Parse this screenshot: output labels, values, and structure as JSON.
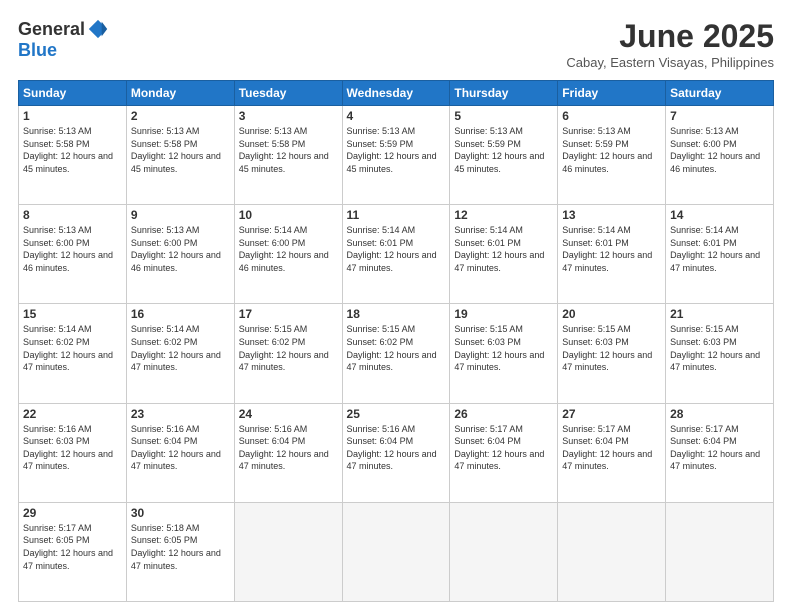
{
  "header": {
    "logo_general": "General",
    "logo_blue": "Blue",
    "month_title": "June 2025",
    "location": "Cabay, Eastern Visayas, Philippines"
  },
  "calendar": {
    "days_of_week": [
      "Sunday",
      "Monday",
      "Tuesday",
      "Wednesday",
      "Thursday",
      "Friday",
      "Saturday"
    ],
    "weeks": [
      [
        {
          "day": null,
          "empty": true
        },
        {
          "day": null,
          "empty": true
        },
        {
          "day": null,
          "empty": true
        },
        {
          "day": null,
          "empty": true
        },
        {
          "day": null,
          "empty": true
        },
        {
          "day": null,
          "empty": true
        },
        {
          "day": null,
          "empty": true
        }
      ],
      [
        {
          "day": 1,
          "sunrise": "5:13 AM",
          "sunset": "5:58 PM",
          "daylight": "12 hours and 45 minutes."
        },
        {
          "day": 2,
          "sunrise": "5:13 AM",
          "sunset": "5:58 PM",
          "daylight": "12 hours and 45 minutes."
        },
        {
          "day": 3,
          "sunrise": "5:13 AM",
          "sunset": "5:58 PM",
          "daylight": "12 hours and 45 minutes."
        },
        {
          "day": 4,
          "sunrise": "5:13 AM",
          "sunset": "5:59 PM",
          "daylight": "12 hours and 45 minutes."
        },
        {
          "day": 5,
          "sunrise": "5:13 AM",
          "sunset": "5:59 PM",
          "daylight": "12 hours and 45 minutes."
        },
        {
          "day": 6,
          "sunrise": "5:13 AM",
          "sunset": "5:59 PM",
          "daylight": "12 hours and 46 minutes."
        },
        {
          "day": 7,
          "sunrise": "5:13 AM",
          "sunset": "6:00 PM",
          "daylight": "12 hours and 46 minutes."
        }
      ],
      [
        {
          "day": 8,
          "sunrise": "5:13 AM",
          "sunset": "6:00 PM",
          "daylight": "12 hours and 46 minutes."
        },
        {
          "day": 9,
          "sunrise": "5:13 AM",
          "sunset": "6:00 PM",
          "daylight": "12 hours and 46 minutes."
        },
        {
          "day": 10,
          "sunrise": "5:14 AM",
          "sunset": "6:00 PM",
          "daylight": "12 hours and 46 minutes."
        },
        {
          "day": 11,
          "sunrise": "5:14 AM",
          "sunset": "6:01 PM",
          "daylight": "12 hours and 47 minutes."
        },
        {
          "day": 12,
          "sunrise": "5:14 AM",
          "sunset": "6:01 PM",
          "daylight": "12 hours and 47 minutes."
        },
        {
          "day": 13,
          "sunrise": "5:14 AM",
          "sunset": "6:01 PM",
          "daylight": "12 hours and 47 minutes."
        },
        {
          "day": 14,
          "sunrise": "5:14 AM",
          "sunset": "6:01 PM",
          "daylight": "12 hours and 47 minutes."
        }
      ],
      [
        {
          "day": 15,
          "sunrise": "5:14 AM",
          "sunset": "6:02 PM",
          "daylight": "12 hours and 47 minutes."
        },
        {
          "day": 16,
          "sunrise": "5:14 AM",
          "sunset": "6:02 PM",
          "daylight": "12 hours and 47 minutes."
        },
        {
          "day": 17,
          "sunrise": "5:15 AM",
          "sunset": "6:02 PM",
          "daylight": "12 hours and 47 minutes."
        },
        {
          "day": 18,
          "sunrise": "5:15 AM",
          "sunset": "6:02 PM",
          "daylight": "12 hours and 47 minutes."
        },
        {
          "day": 19,
          "sunrise": "5:15 AM",
          "sunset": "6:03 PM",
          "daylight": "12 hours and 47 minutes."
        },
        {
          "day": 20,
          "sunrise": "5:15 AM",
          "sunset": "6:03 PM",
          "daylight": "12 hours and 47 minutes."
        },
        {
          "day": 21,
          "sunrise": "5:15 AM",
          "sunset": "6:03 PM",
          "daylight": "12 hours and 47 minutes."
        }
      ],
      [
        {
          "day": 22,
          "sunrise": "5:16 AM",
          "sunset": "6:03 PM",
          "daylight": "12 hours and 47 minutes."
        },
        {
          "day": 23,
          "sunrise": "5:16 AM",
          "sunset": "6:04 PM",
          "daylight": "12 hours and 47 minutes."
        },
        {
          "day": 24,
          "sunrise": "5:16 AM",
          "sunset": "6:04 PM",
          "daylight": "12 hours and 47 minutes."
        },
        {
          "day": 25,
          "sunrise": "5:16 AM",
          "sunset": "6:04 PM",
          "daylight": "12 hours and 47 minutes."
        },
        {
          "day": 26,
          "sunrise": "5:17 AM",
          "sunset": "6:04 PM",
          "daylight": "12 hours and 47 minutes."
        },
        {
          "day": 27,
          "sunrise": "5:17 AM",
          "sunset": "6:04 PM",
          "daylight": "12 hours and 47 minutes."
        },
        {
          "day": 28,
          "sunrise": "5:17 AM",
          "sunset": "6:04 PM",
          "daylight": "12 hours and 47 minutes."
        }
      ],
      [
        {
          "day": 29,
          "sunrise": "5:17 AM",
          "sunset": "6:05 PM",
          "daylight": "12 hours and 47 minutes."
        },
        {
          "day": 30,
          "sunrise": "5:18 AM",
          "sunset": "6:05 PM",
          "daylight": "12 hours and 47 minutes."
        },
        {
          "day": null,
          "empty": true
        },
        {
          "day": null,
          "empty": true
        },
        {
          "day": null,
          "empty": true
        },
        {
          "day": null,
          "empty": true
        },
        {
          "day": null,
          "empty": true
        }
      ]
    ]
  }
}
